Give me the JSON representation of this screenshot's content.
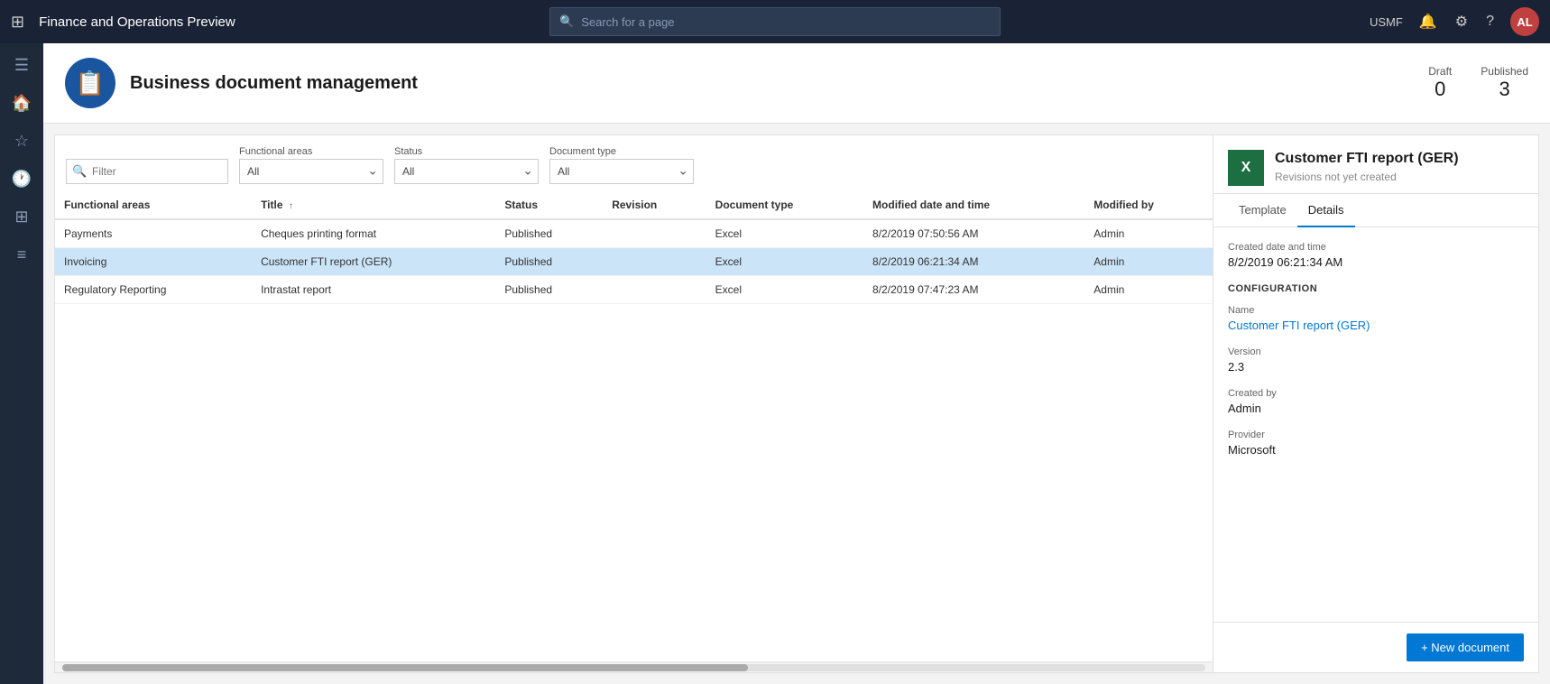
{
  "topnav": {
    "title": "Finance and Operations Preview",
    "search_placeholder": "Search for a page",
    "username": "USMF",
    "avatar_initials": "AL"
  },
  "page_header": {
    "icon_symbol": "📄",
    "title": "Business document management",
    "draft_label": "Draft",
    "draft_value": "0",
    "published_label": "Published",
    "published_value": "3"
  },
  "filters": {
    "filter_placeholder": "Filter",
    "functional_areas_label": "Functional areas",
    "functional_areas_value": "All",
    "status_label": "Status",
    "status_value": "All",
    "document_type_label": "Document type",
    "document_type_value": "All"
  },
  "table": {
    "columns": [
      "Functional areas",
      "Title",
      "Status",
      "Revision",
      "Document type",
      "Modified date and time",
      "Modified by"
    ],
    "rows": [
      {
        "functional_area": "Payments",
        "title": "Cheques printing format",
        "status": "Published",
        "revision": "",
        "document_type": "Excel",
        "modified_datetime": "8/2/2019 07:50:56 AM",
        "modified_by": "Admin",
        "selected": false
      },
      {
        "functional_area": "Invoicing",
        "title": "Customer FTI report (GER)",
        "status": "Published",
        "revision": "",
        "document_type": "Excel",
        "modified_datetime": "8/2/2019 06:21:34 AM",
        "modified_by": "Admin",
        "selected": true
      },
      {
        "functional_area": "Regulatory Reporting",
        "title": "Intrastat report",
        "status": "Published",
        "revision": "",
        "document_type": "Excel",
        "modified_datetime": "8/2/2019 07:47:23 AM",
        "modified_by": "Admin",
        "selected": false
      }
    ]
  },
  "right_panel": {
    "title": "Customer FTI report (GER)",
    "subtitle": "Revisions not yet created",
    "tab_template": "Template",
    "tab_details": "Details",
    "created_label": "Created date and time",
    "created_value": "8/2/2019 06:21:34 AM",
    "section_config": "CONFIGURATION",
    "name_label": "Name",
    "name_value": "Customer FTI report (GER)",
    "version_label": "Version",
    "version_value": "2.3",
    "created_by_label": "Created by",
    "created_by_value": "Admin",
    "provider_label": "Provider",
    "provider_value": "Microsoft",
    "new_doc_btn": "+ New document"
  }
}
